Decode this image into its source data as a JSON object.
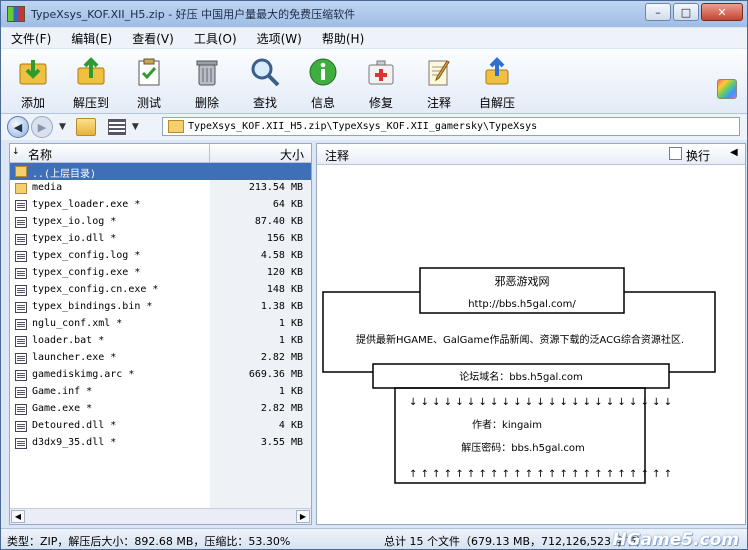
{
  "window": {
    "title": "TypeXsys_KOF.XII_H5.zip - 好压 中国用户量最大的免费压缩软件"
  },
  "menu": [
    "文件(F)",
    "编辑(E)",
    "查看(V)",
    "工具(O)",
    "选项(W)",
    "帮助(H)"
  ],
  "toolbar": [
    "添加",
    "解压到",
    "测试",
    "删除",
    "查找",
    "信息",
    "修复",
    "注释",
    "自解压"
  ],
  "address": {
    "path": "TypeXsys_KOF.XII_H5.zip\\TypeXsys_KOF.XII_gamersky\\TypeXsys"
  },
  "filelist": {
    "col_name": "名称",
    "col_size": "大小",
    "rows": [
      {
        "name": "..(上层目录)",
        "size": ""
      },
      {
        "name": "media",
        "size": "213.54 MB"
      },
      {
        "name": "typex_loader.exe *",
        "size": "64 KB"
      },
      {
        "name": "typex_io.log *",
        "size": "87.40 KB"
      },
      {
        "name": "typex_io.dll *",
        "size": "156 KB"
      },
      {
        "name": "typex_config.log *",
        "size": "4.58 KB"
      },
      {
        "name": "typex_config.exe *",
        "size": "120 KB"
      },
      {
        "name": "typex_config.cn.exe *",
        "size": "148 KB"
      },
      {
        "name": "typex_bindings.bin *",
        "size": "1.38 KB"
      },
      {
        "name": "nglu_conf.xml *",
        "size": "1 KB"
      },
      {
        "name": "loader.bat *",
        "size": "1 KB"
      },
      {
        "name": "launcher.exe *",
        "size": "2.82 MB"
      },
      {
        "name": "gamediskimg.arc *",
        "size": "669.36 MB"
      },
      {
        "name": "Game.inf *",
        "size": "1 KB"
      },
      {
        "name": "Game.exe *",
        "size": "2.82 MB"
      },
      {
        "name": "Detoured.dll *",
        "size": "4 KB"
      },
      {
        "name": "d3dx9_35.dll *",
        "size": "3.55 MB"
      }
    ]
  },
  "comment": {
    "title": "注释",
    "wrap_label": "换行",
    "site_name": "邪恶游戏网",
    "site_url": "http://bbs.h5gal.com/",
    "description": "提供最新HGAME、GalGame作品新闻、资源下载的泛ACG综合资源社区.",
    "forum_line": "论坛域名：bbs.h5gal.com",
    "author_line": "作者：kingaim",
    "password_line": "解压密码：bbs.h5gal.com"
  },
  "status": {
    "left": "类型：ZIP，解压后大小：892.68 MB，压缩比：53.30%",
    "right": "总计 15 个文件（679.13 MB，712,126,523 字节）"
  },
  "watermark": "HGame5.com"
}
